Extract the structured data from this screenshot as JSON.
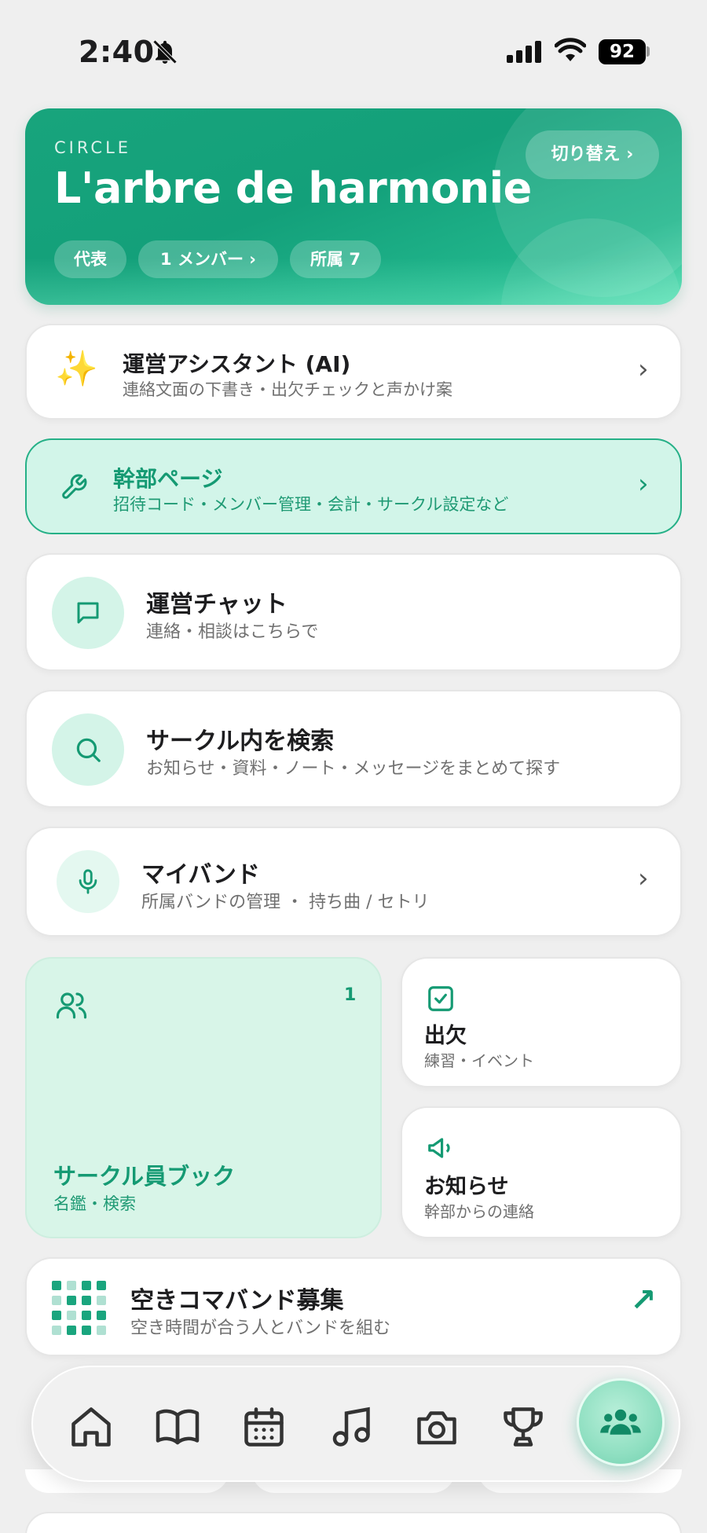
{
  "status": {
    "time": "2:40",
    "battery": "92"
  },
  "circle": {
    "eyebrow": "CIRCLE",
    "name": "L'arbre de harmonie",
    "switch_label": "切り替え ›",
    "chips": [
      "代表",
      "1 メンバー ›",
      "所属 7"
    ]
  },
  "ai": {
    "icon": "✨",
    "title": "運営アシスタント (AI)",
    "sub": "連絡文面の下書き・出欠チェックと声かけ案",
    "chevron": "›"
  },
  "admin": {
    "title": "幹部ページ",
    "sub": "招待コード・メンバー管理・会計・サークル設定など",
    "chevron": "›"
  },
  "chat": {
    "title": "運営チャット",
    "sub": "連絡・相談はこちらで"
  },
  "search": {
    "title": "サークル内を検索",
    "sub": "お知らせ・資料・ノート・メッセージをまとめて探す"
  },
  "myband": {
    "title": "マイバンド",
    "sub": "所属バンドの管理 ・ 持ち曲 / セトリ",
    "chevron": "›"
  },
  "members": {
    "count": "1",
    "title": "サークル員ブック",
    "sub": "名鑑・検索"
  },
  "attendance": {
    "title": "出欠",
    "sub": "練習・イベント"
  },
  "notice": {
    "title": "お知らせ",
    "sub": "幹部からの連絡"
  },
  "freeband": {
    "title": "空きコマバンド募集",
    "sub": "空き時間が合う人とバンドを組む",
    "arrow": "↗"
  },
  "colors": {
    "accent": "#159a73",
    "accent_light": "#d2f5e9"
  },
  "nav": [
    "home-icon",
    "book-icon",
    "calendar-icon",
    "music-icon",
    "camera-icon",
    "trophy-icon",
    "people-icon"
  ]
}
